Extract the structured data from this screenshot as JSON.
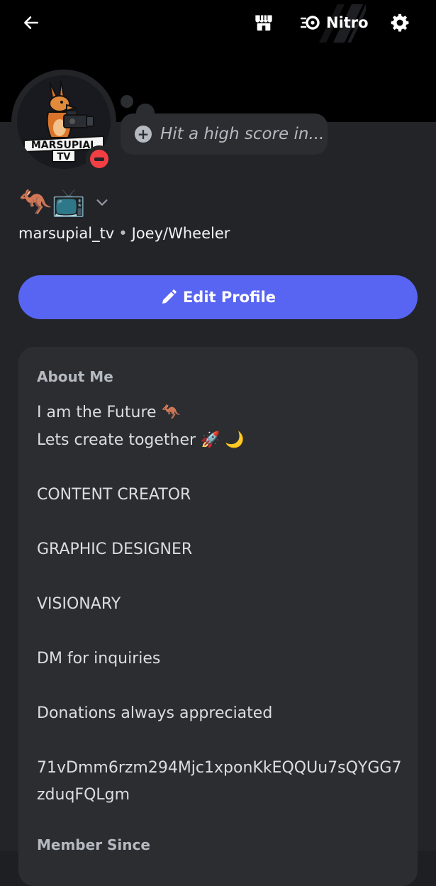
{
  "topbar": {
    "back_icon": "arrow-left-icon",
    "shop_icon": "shop-icon",
    "nitro_label": "Nitro",
    "nitro_icon": "nitro-icon",
    "settings_icon": "gear-icon"
  },
  "profile": {
    "avatar_logo_lines": [
      "MARSUPIAL",
      "TV"
    ],
    "status": "do-not-disturb",
    "custom_status_placeholder": "Hit a high score in...",
    "display_name": "🦘📺",
    "username": "marsupial_tv",
    "separator": "•",
    "pronouns": "Joey/Wheeler"
  },
  "actions": {
    "edit_profile_label": "Edit Profile"
  },
  "about": {
    "heading": "About Me",
    "text": "I am the Future 🦘\nLets create together 🚀 🌙\n\nCONTENT CREATOR\n\nGRAPHIC DESIGNER\n\nVISIONARY\n\nDM for inquiries\n\nDonations always appreciated\n\n71vDmm6rzm294Mjc1xponKkEQQUu7sQYGG7zduqFQLgm",
    "member_since_heading": "Member Since"
  },
  "colors": {
    "accent": "#5865f2",
    "dnd": "#f23f43",
    "card": "#2b2d31",
    "background": "#232428"
  }
}
